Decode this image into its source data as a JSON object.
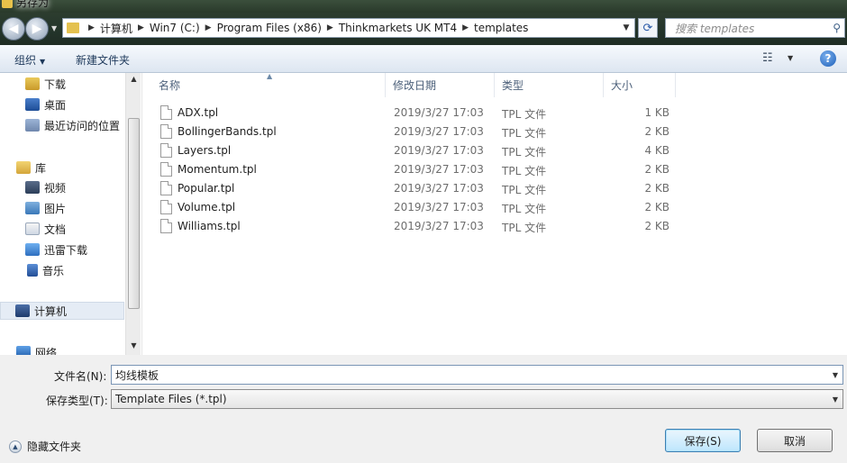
{
  "window": {
    "title": "另存为"
  },
  "address": {
    "crumbs": [
      "计算机",
      "Win7 (C:)",
      "Program Files (x86)",
      "Thinkmarkets UK MT4",
      "templates"
    ],
    "search_placeholder": "搜索 templates"
  },
  "toolbar": {
    "organize": "组织",
    "new_folder": "新建文件夹"
  },
  "nav": {
    "items": [
      {
        "label": "下载",
        "icon": "download-folder-icon"
      },
      {
        "label": "桌面",
        "icon": "desktop-icon"
      },
      {
        "label": "最近访问的位置",
        "icon": "recent-places-icon"
      },
      {
        "label": "库",
        "icon": "library-icon"
      },
      {
        "label": "视频",
        "icon": "video-library-icon"
      },
      {
        "label": "图片",
        "icon": "pictures-library-icon"
      },
      {
        "label": "文档",
        "icon": "documents-library-icon"
      },
      {
        "label": "迅雷下载",
        "icon": "xunlei-download-icon"
      },
      {
        "label": "音乐",
        "icon": "music-library-icon"
      },
      {
        "label": "计算机",
        "icon": "computer-icon"
      },
      {
        "label": "网络",
        "icon": "network-icon"
      }
    ]
  },
  "columns": {
    "name": "名称",
    "modified": "修改日期",
    "type": "类型",
    "size": "大小"
  },
  "files": [
    {
      "name": "ADX.tpl",
      "modified": "2019/3/27 17:03",
      "type": "TPL 文件",
      "size": "1 KB"
    },
    {
      "name": "BollingerBands.tpl",
      "modified": "2019/3/27 17:03",
      "type": "TPL 文件",
      "size": "2 KB"
    },
    {
      "name": "Layers.tpl",
      "modified": "2019/3/27 17:03",
      "type": "TPL 文件",
      "size": "4 KB"
    },
    {
      "name": "Momentum.tpl",
      "modified": "2019/3/27 17:03",
      "type": "TPL 文件",
      "size": "2 KB"
    },
    {
      "name": "Popular.tpl",
      "modified": "2019/3/27 17:03",
      "type": "TPL 文件",
      "size": "2 KB"
    },
    {
      "name": "Volume.tpl",
      "modified": "2019/3/27 17:03",
      "type": "TPL 文件",
      "size": "2 KB"
    },
    {
      "name": "Williams.tpl",
      "modified": "2019/3/27 17:03",
      "type": "TPL 文件",
      "size": "2 KB"
    }
  ],
  "form": {
    "filename_label": "文件名(N):",
    "filename_value": "均线模板",
    "filetype_label": "保存类型(T):",
    "filetype_value": "Template Files (*.tpl)"
  },
  "footer": {
    "hide_folders": "隐藏文件夹",
    "save": "保存(S)",
    "cancel": "取消"
  }
}
